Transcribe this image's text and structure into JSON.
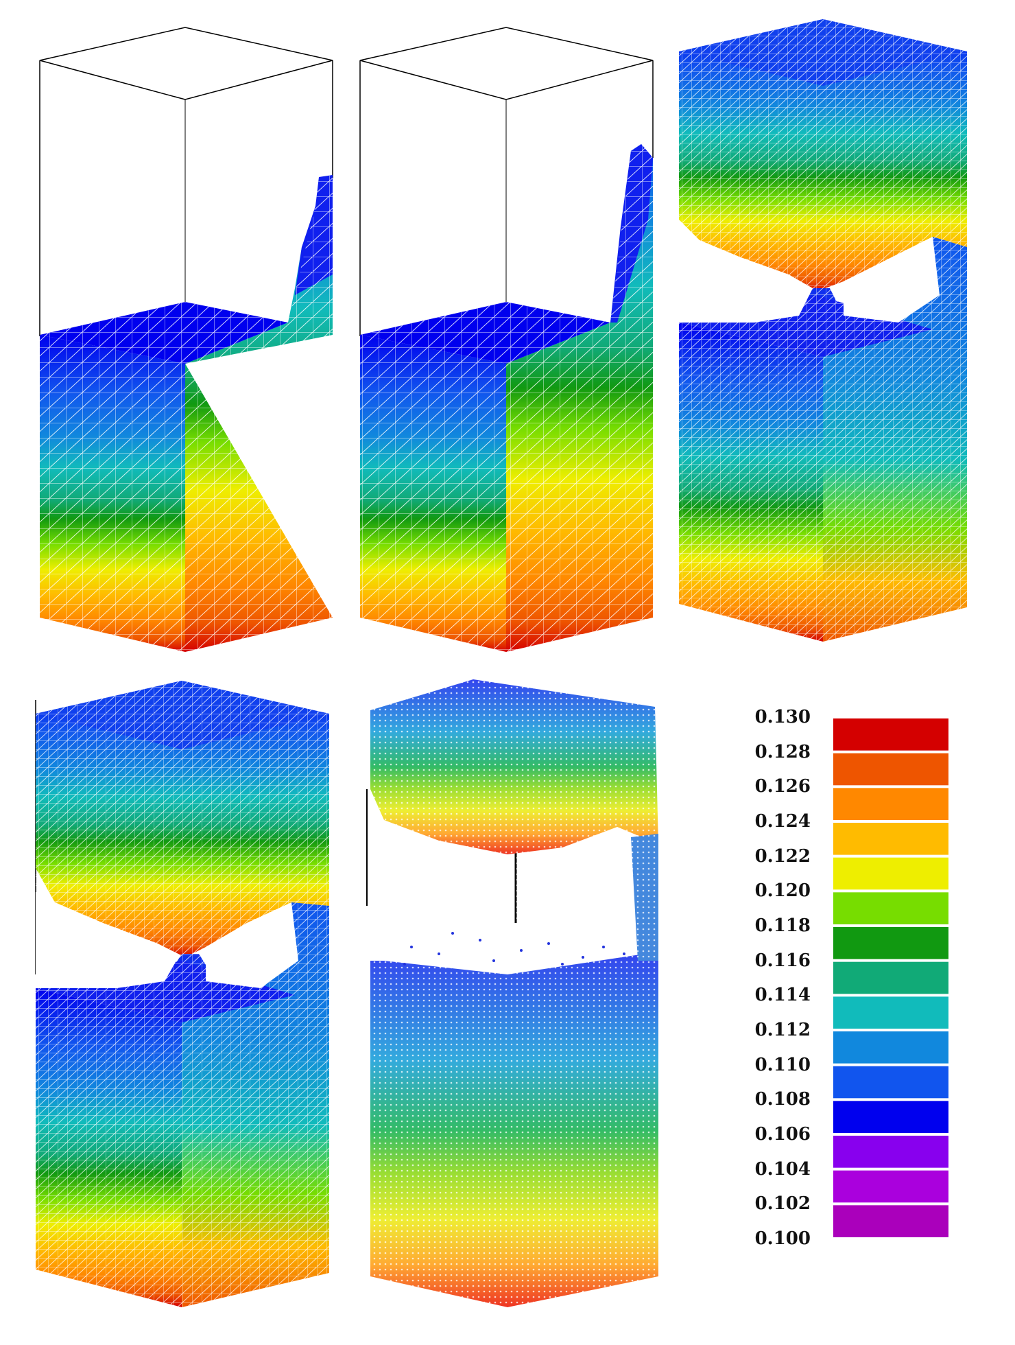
{
  "panels": [
    {
      "id": "panel-1",
      "state": "initial-dam-break",
      "mesh": "triangulated",
      "frame_outline": true
    },
    {
      "id": "panel-2",
      "state": "dam-break-rising-wall",
      "mesh": "triangulated",
      "frame_outline": true
    },
    {
      "id": "panel-3",
      "state": "slosh-top-with-bridge",
      "mesh": "triangulated",
      "frame_outline": false
    },
    {
      "id": "panel-4",
      "state": "slosh-top-with-bridge",
      "mesh": "triangulated",
      "frame_outline": true
    },
    {
      "id": "panel-5",
      "state": "particle-view",
      "mesh": "points",
      "frame_outline": true
    }
  ],
  "legend": {
    "labels": [
      "0.130",
      "0.128",
      "0.126",
      "0.124",
      "0.122",
      "0.120",
      "0.118",
      "0.116",
      "0.114",
      "0.112",
      "0.110",
      "0.108",
      "0.106",
      "0.104",
      "0.102",
      "0.100"
    ],
    "colors": [
      "#d40000",
      "#ee5500",
      "#ff8800",
      "#ffbb00",
      "#eeee00",
      "#77dd00",
      "#119911",
      "#11aa77",
      "#11bbbb",
      "#1188dd",
      "#1155ee",
      "#0000ee",
      "#8800ee",
      "#aa00dd",
      "#aa00bb"
    ]
  },
  "colors": {
    "background": "#ffffff",
    "mesh_lines": "#ffffff",
    "frame_lines": "#000000"
  }
}
